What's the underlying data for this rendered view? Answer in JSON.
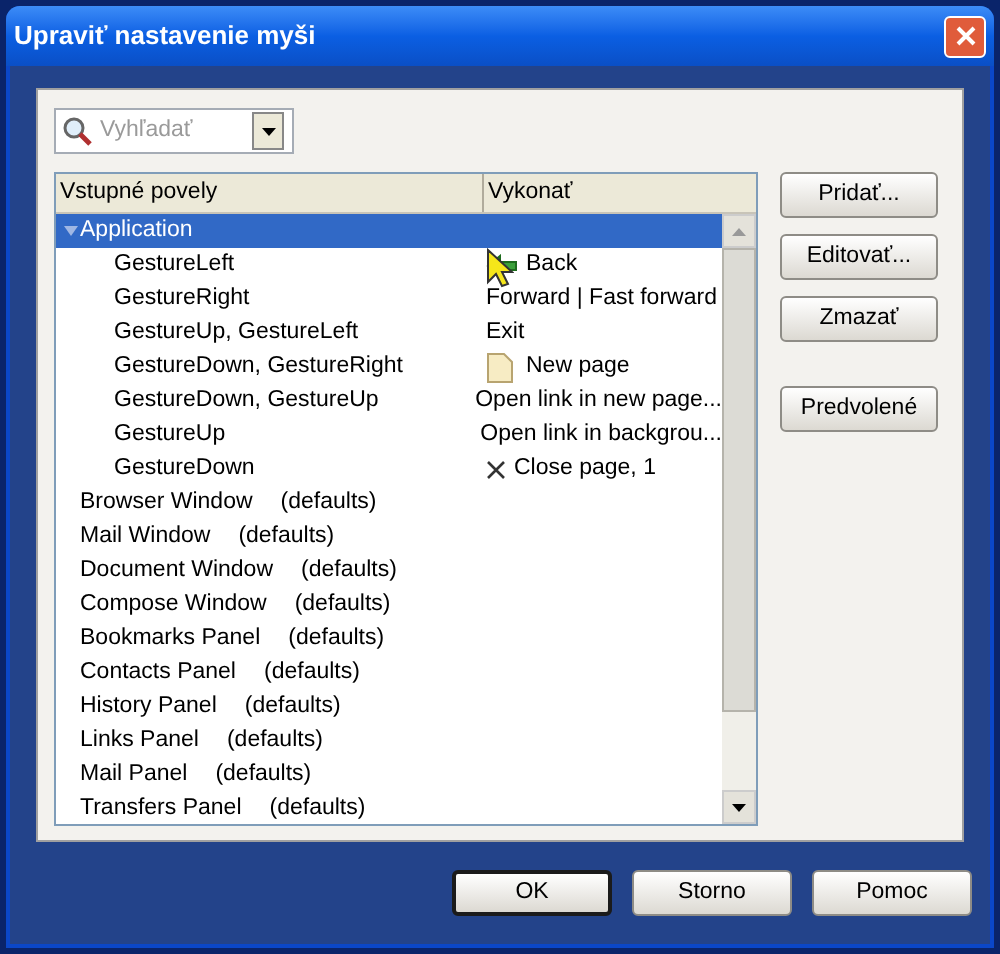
{
  "window": {
    "title": "Upraviť nastavenie myši"
  },
  "search": {
    "placeholder": "Vyhľadať"
  },
  "table": {
    "columns": [
      "Vstupné povely",
      "Vykonať"
    ],
    "rows": [
      {
        "label": "Application",
        "expanded": true,
        "selected": true,
        "children": [
          {
            "gesture": "GestureLeft",
            "action": "Back",
            "kind": "back"
          },
          {
            "gesture": "GestureRight",
            "action": "Forward | Fast forward"
          },
          {
            "gesture": "GestureUp, GestureLeft",
            "action": "Exit"
          },
          {
            "gesture": "GestureDown, GestureRight",
            "action": "New page",
            "kind": "page"
          },
          {
            "gesture": "GestureDown, GestureUp",
            "action": "Open link in new page..."
          },
          {
            "gesture": "GestureUp",
            "action": "Open link in backgrou..."
          },
          {
            "gesture": "GestureDown",
            "action": "Close page, 1",
            "kind": "close"
          }
        ]
      },
      {
        "label": "Browser Window",
        "note": "(defaults)",
        "expanded": false,
        "selected": false
      },
      {
        "label": "Mail Window",
        "note": "(defaults)",
        "expanded": false,
        "selected": false
      },
      {
        "label": "Document Window",
        "note": "(defaults)",
        "expanded": false,
        "selected": false
      },
      {
        "label": "Compose Window",
        "note": "(defaults)",
        "expanded": false,
        "selected": false
      },
      {
        "label": "Bookmarks Panel",
        "note": "(defaults)",
        "expanded": false,
        "selected": false
      },
      {
        "label": "Contacts Panel",
        "note": "(defaults)",
        "expanded": false,
        "selected": false
      },
      {
        "label": "History Panel",
        "note": "(defaults)",
        "expanded": false,
        "selected": false
      },
      {
        "label": "Links Panel",
        "note": "(defaults)",
        "expanded": false,
        "selected": false
      },
      {
        "label": "Mail Panel",
        "note": "(defaults)",
        "expanded": false,
        "selected": false
      },
      {
        "label": "Transfers Panel",
        "note": "(defaults)",
        "expanded": false,
        "selected": false
      }
    ]
  },
  "side_buttons": [
    "Pridať...",
    "Editovať...",
    "Zmazať",
    "Predvolené"
  ],
  "footer_buttons": [
    {
      "label": "OK",
      "default": true
    },
    {
      "label": "Storno",
      "default": false
    },
    {
      "label": "Pomoc",
      "default": false
    }
  ]
}
